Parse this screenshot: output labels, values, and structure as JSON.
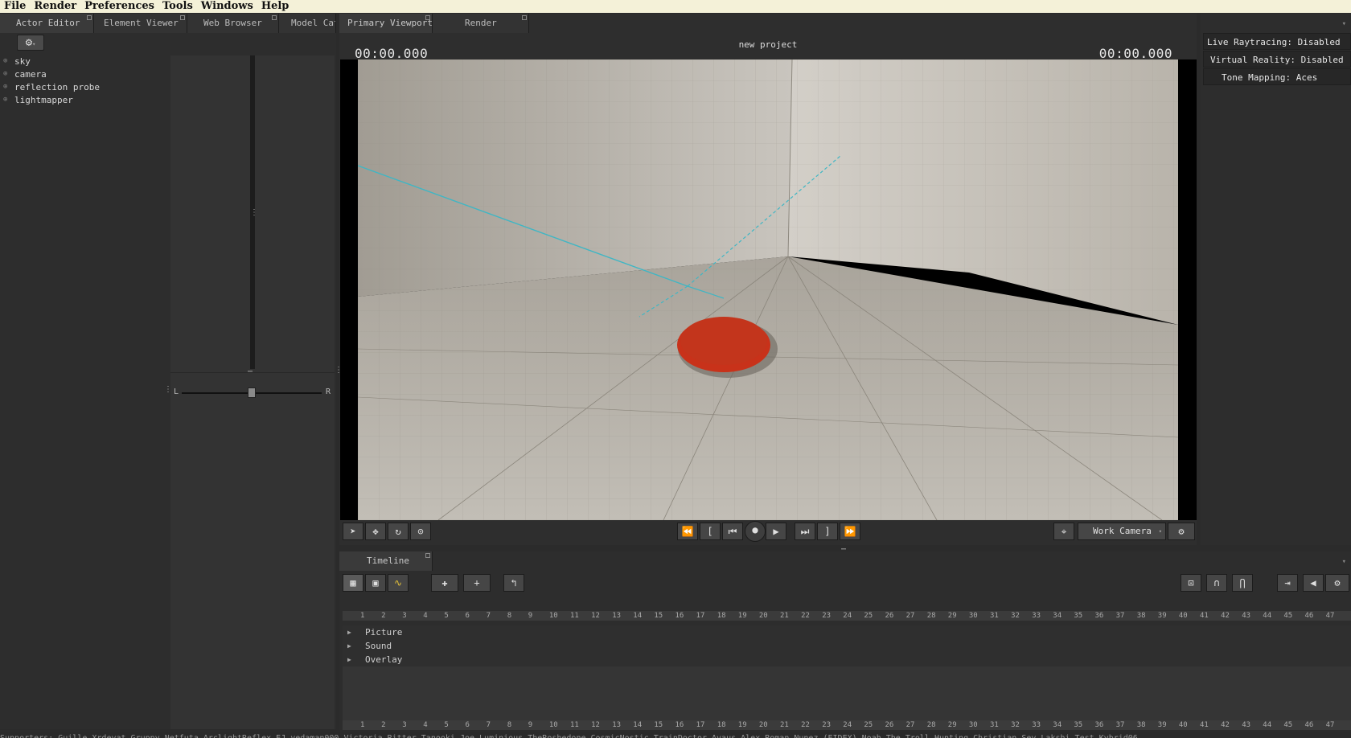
{
  "menu": [
    "File",
    "Render",
    "Preferences",
    "Tools",
    "Windows",
    "Help"
  ],
  "left_tabs": [
    "Actor Editor",
    "Element Viewer",
    "Web Browser",
    "Model Cat"
  ],
  "actors": [
    "sky",
    "camera",
    "reflection probe",
    "lightmapper"
  ],
  "balance": {
    "left": "L",
    "right": "R"
  },
  "viewport_tabs": [
    "Primary Viewport",
    "Render"
  ],
  "viewport": {
    "title": "new project",
    "time_left": "00:00.000",
    "time_right": "00:00.000",
    "camera": "Work Camera"
  },
  "status": {
    "raytracing": "Live Raytracing: Disabled",
    "vr": "Virtual Reality: Disabled",
    "tonemapping": "Tone Mapping: Aces"
  },
  "timeline": {
    "tab": "Timeline",
    "tracks": [
      "Picture",
      "Sound",
      "Overlay"
    ],
    "ruler": [
      "1",
      "2",
      "3",
      "4",
      "5",
      "6",
      "7",
      "8",
      "9",
      "10",
      "11",
      "12",
      "13",
      "14",
      "15",
      "16",
      "17",
      "18",
      "19",
      "20",
      "21",
      "22",
      "23",
      "24",
      "25",
      "26",
      "27",
      "28",
      "29",
      "30",
      "31",
      "32",
      "33",
      "34",
      "35",
      "36",
      "37",
      "38",
      "39",
      "40",
      "41",
      "42",
      "43",
      "44",
      "45",
      "46",
      "47"
    ]
  },
  "footer": "Supporters: Guille Xrdevat Gruppy Netfuta ArclightReflex EJ yedaman000 Victoria Ritter Tanooki Joe Luminious TheRoshedone CosmicNostic TrainDoctor Avaus Alex Roman Nunez (EIDEX) Noah The Troll Hunting Christian Sey Lakshi Test Kybrid06",
  "colors": {
    "menubar": "#f4f1d8",
    "accent_disc": "#c8321a",
    "guide_line": "#3fb6c4"
  }
}
